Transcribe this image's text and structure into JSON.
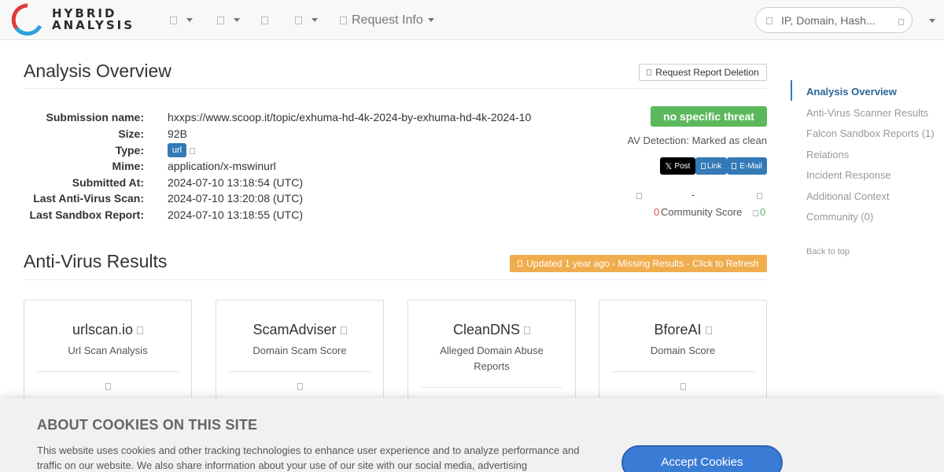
{
  "brand": {
    "line1": "HYBRID",
    "line2": "ANALYSIS"
  },
  "nav": {
    "request_info": "Request Info"
  },
  "search": {
    "placeholder": "IP, Domain, Hash..."
  },
  "overview": {
    "title": "Analysis Overview",
    "delete_button": "Request Report Deletion",
    "fields": [
      {
        "label": "Submission name:",
        "value": "hxxps://www.scoop.it/topic/exhuma-hd-4k-2024-by-exhuma-hd-4k-2024-10"
      },
      {
        "label": "Size:",
        "value": "92B"
      },
      {
        "label": "Type:",
        "value": "url"
      },
      {
        "label": "Mime:",
        "value": "application/x-mswinurl"
      },
      {
        "label": "Submitted At:",
        "value": "2024-07-10 13:18:54 (UTC)"
      },
      {
        "label": "Last Anti-Virus Scan:",
        "value": "2024-07-10 13:20:08 (UTC)"
      },
      {
        "label": "Last Sandbox Report:",
        "value": "2024-07-10 13:18:55 (UTC)"
      }
    ],
    "verdict": "no specific threat",
    "av_detection": "AV Detection: Marked as clean",
    "share": {
      "post": "Post",
      "link": "Link",
      "email": "E-Mail"
    },
    "community": {
      "dash": "-",
      "down": "0",
      "label": "Community Score",
      "up": "0"
    }
  },
  "av_results": {
    "title": "Anti-Virus Results",
    "refresh_button": "Updated 1 year ago - Missing Results - Click to Refresh",
    "cards": [
      {
        "name": "urlscan.io",
        "subtitle": "Url Scan Analysis"
      },
      {
        "name": "ScamAdviser",
        "subtitle": "Domain Scam Score"
      },
      {
        "name": "CleanDNS",
        "subtitle": "Alleged Domain Abuse Reports"
      },
      {
        "name": "BforeAI",
        "subtitle": "Domain Score"
      }
    ]
  },
  "sidebar": {
    "items": [
      "Analysis Overview",
      "Anti-Virus Scanner Results",
      "Falcon Sandbox Reports (1)",
      "Relations",
      "Incident Response",
      "Additional Context",
      "Community (0)"
    ],
    "back_to_top": "Back to top"
  },
  "cookies": {
    "title": "ABOUT COOKIES ON THIS SITE",
    "text": "This website uses cookies and other tracking technologies to enhance user experience and to analyze performance and traffic on our website. We also share information about your use of our site with our social media, advertising",
    "accept": "Accept Cookies"
  },
  "colors": {
    "primary": "#337ab7",
    "success": "#5cb85c",
    "warning": "#f0ad4e",
    "twitter": "#000000"
  }
}
